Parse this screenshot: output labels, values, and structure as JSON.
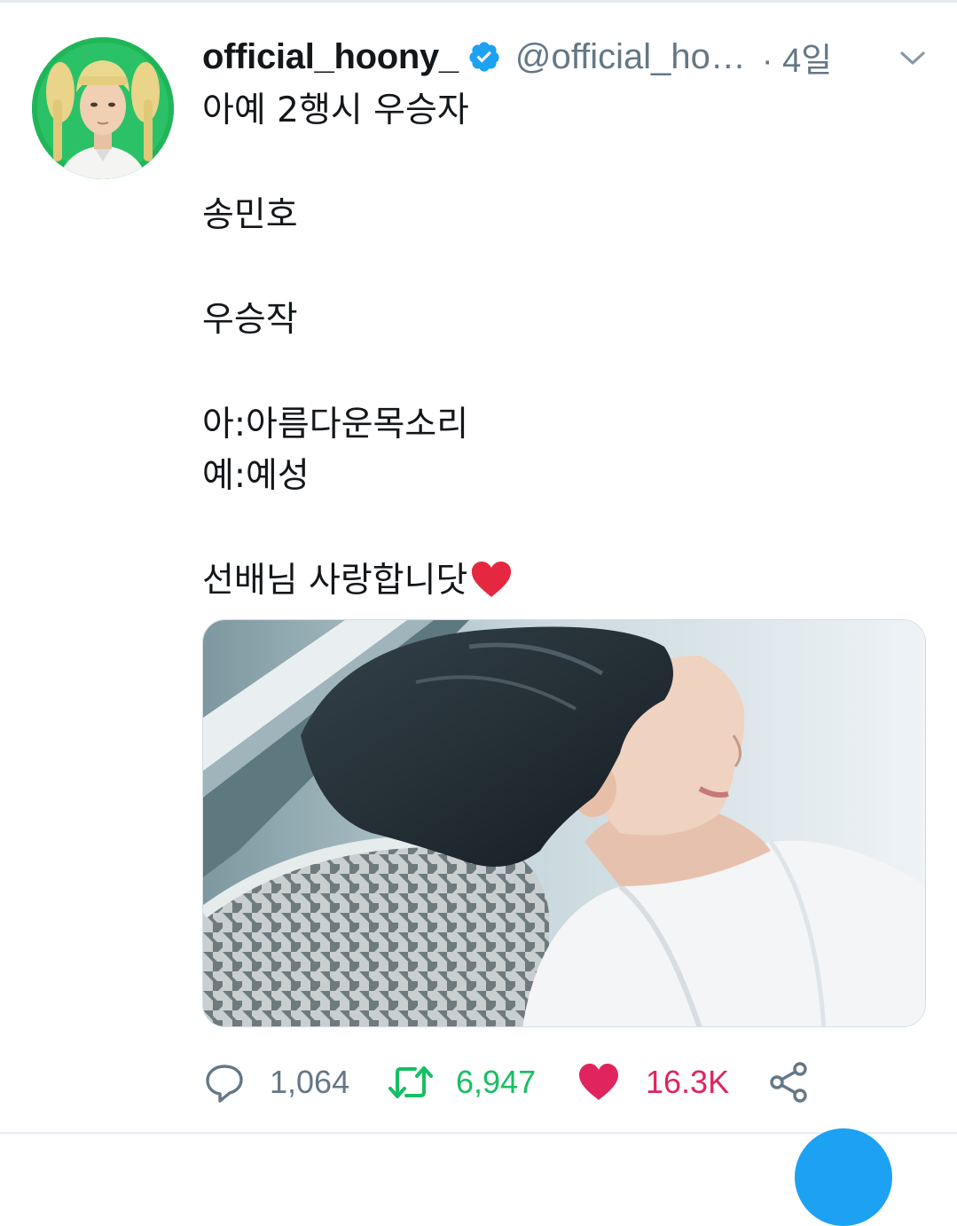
{
  "tweet": {
    "display_name": "official_hoony_",
    "handle": "@official_ho…",
    "time": "· 4일",
    "verified": true,
    "avatar_icon": "avatar-blonde-pigtails",
    "text_lines": [
      "아예 2행시 우승자",
      "송민호",
      "우승작",
      "아:아름다운목소리",
      "예:예성",
      "선배님 사랑합니닷"
    ],
    "emoji": "red-heart",
    "media_icon": "photo-man-white-shirt"
  },
  "actions": {
    "reply_count": "1,064",
    "retweet_count": "6,947",
    "like_count": "16.3K",
    "reply_icon": "reply-icon",
    "retweet_icon": "retweet-icon",
    "like_icon": "heart-icon",
    "share_icon": "share-icon"
  },
  "colors": {
    "text": "#14171a",
    "secondary": "#657786",
    "verified": "#1da1f2",
    "retweet": "#17bf63",
    "like": "#e0245e"
  }
}
